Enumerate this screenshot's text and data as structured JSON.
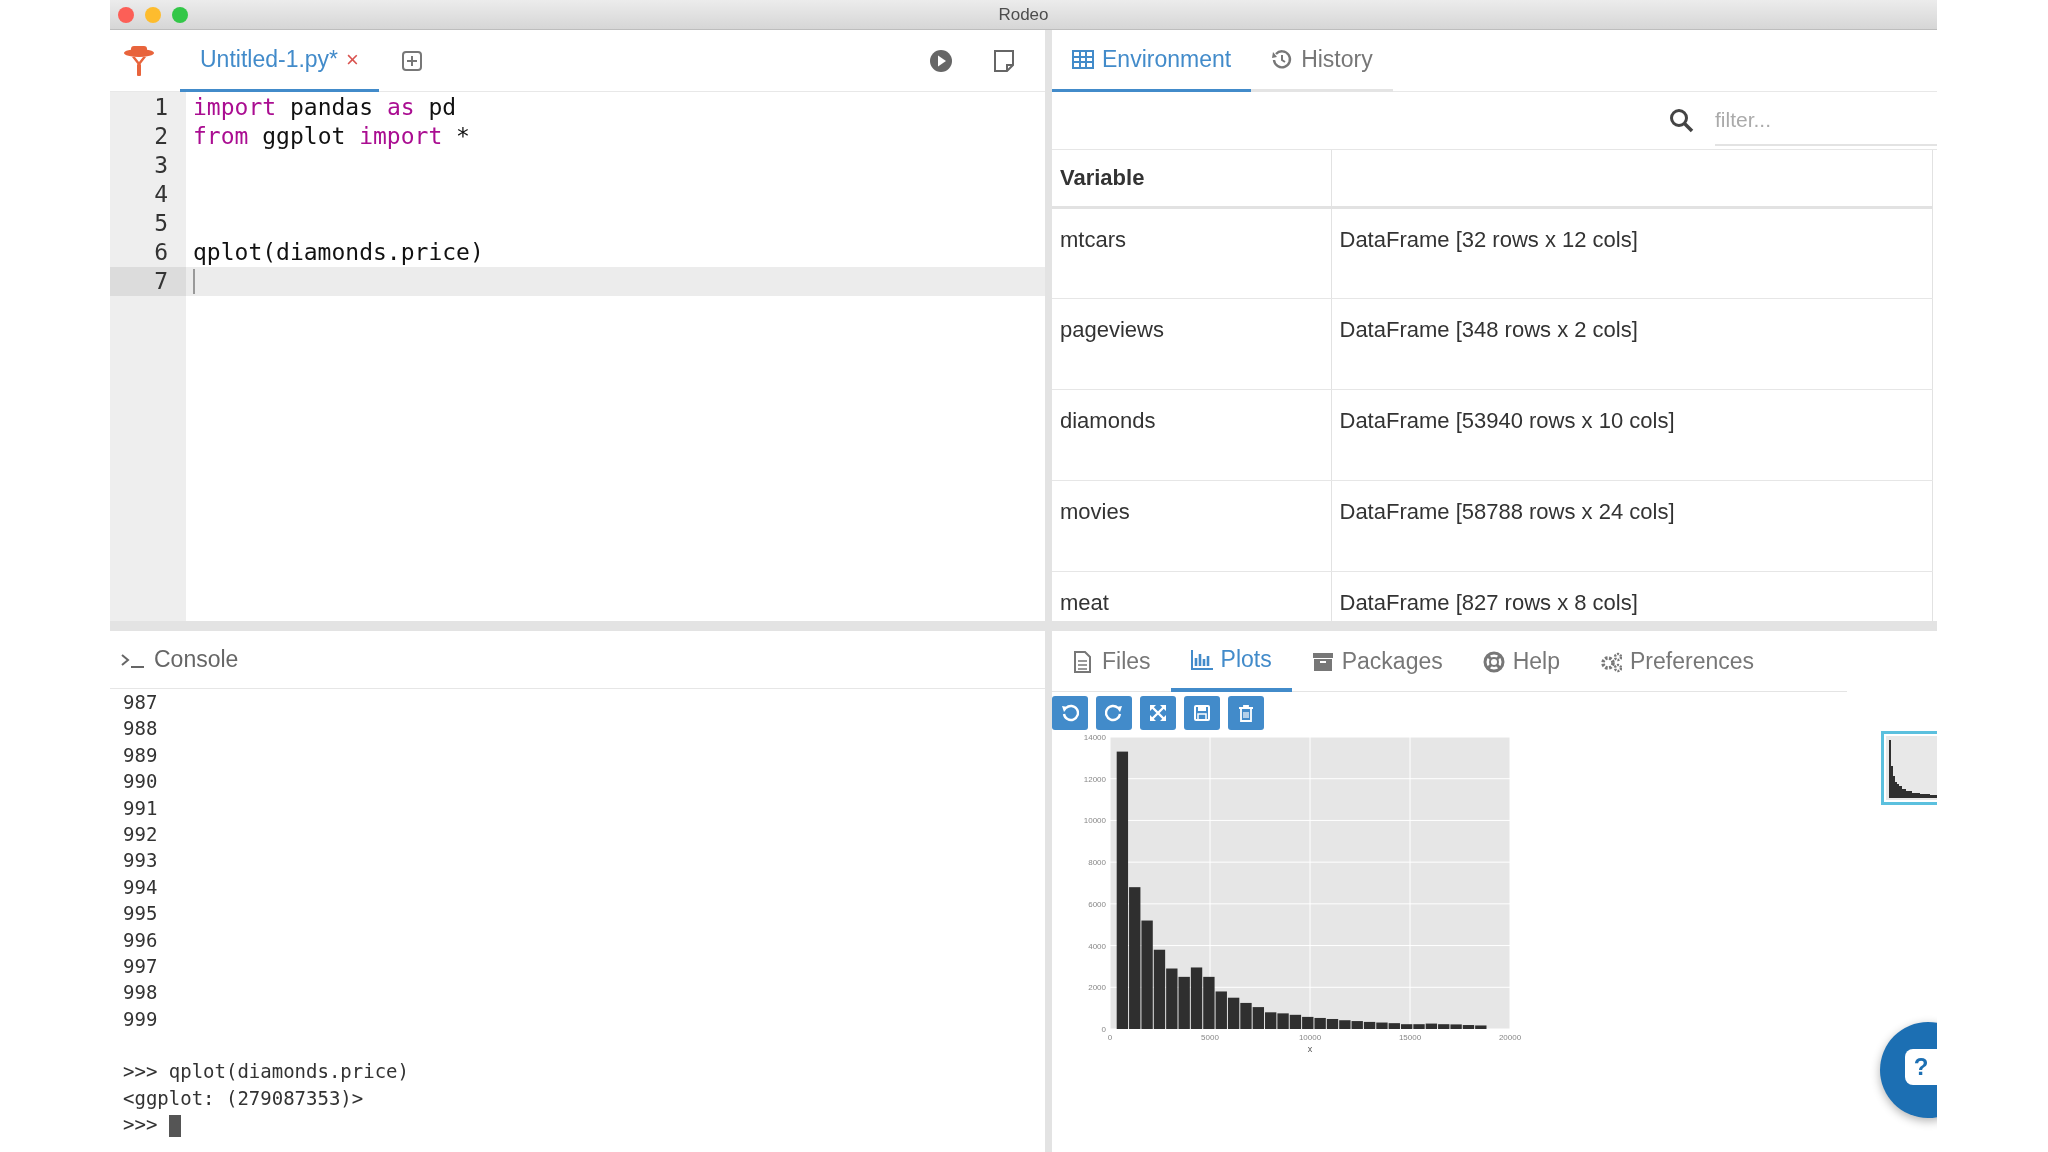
{
  "window": {
    "title": "Rodeo"
  },
  "editor": {
    "tabs": [
      {
        "label": "Untitled-1.py*",
        "close": "×",
        "selected": true
      }
    ],
    "lines": [
      {
        "number": "1",
        "current": false,
        "tokens": [
          {
            "text": "import",
            "kind": "keyword"
          },
          {
            "text": " pandas ",
            "kind": "plain"
          },
          {
            "text": "as",
            "kind": "keyword"
          },
          {
            "text": " pd",
            "kind": "plain"
          }
        ]
      },
      {
        "number": "2",
        "current": false,
        "tokens": [
          {
            "text": "from",
            "kind": "keyword"
          },
          {
            "text": " ggplot ",
            "kind": "plain"
          },
          {
            "text": "import",
            "kind": "keyword"
          },
          {
            "text": " *",
            "kind": "plain"
          }
        ]
      },
      {
        "number": "3",
        "current": false
      },
      {
        "number": "4",
        "current": false
      },
      {
        "number": "5",
        "current": false
      },
      {
        "number": "6",
        "current": false,
        "tokens": [
          {
            "text": "qplot(diamonds.price)",
            "kind": "plain"
          }
        ]
      },
      {
        "number": "7",
        "current": true
      }
    ]
  },
  "environment": {
    "tabs": [
      {
        "label": "Environment",
        "selected": true
      },
      {
        "label": "History",
        "selected": false
      }
    ],
    "filter": {
      "placeholder": "filter..."
    },
    "columns": [
      "Variable"
    ],
    "rows": [
      {
        "name": "mtcars",
        "value": "DataFrame [32 rows x 12 cols]"
      },
      {
        "name": "pageviews",
        "value": "DataFrame [348 rows x 2 cols]"
      },
      {
        "name": "diamonds",
        "value": "DataFrame [53940 rows x 10 cols]"
      },
      {
        "name": "movies",
        "value": "DataFrame [58788 rows x 24 cols]"
      },
      {
        "name": "meat",
        "value": "DataFrame [827 rows x 8 cols]"
      }
    ]
  },
  "console": {
    "title": "Console",
    "output": [
      "987",
      "988",
      "989",
      "990",
      "991",
      "992",
      "993",
      "994",
      "995",
      "996",
      "997",
      "998",
      "999"
    ],
    "session": [
      ">>> qplot(diamonds.price)",
      "<ggplot: (279087353)>"
    ],
    "prompt": ">>>"
  },
  "viewer": {
    "tabs": [
      {
        "label": "Files",
        "selected": false
      },
      {
        "label": "Plots",
        "selected": true
      },
      {
        "label": "Packages",
        "selected": false
      },
      {
        "label": "Help",
        "selected": false
      },
      {
        "label": "Preferences",
        "selected": false
      }
    ],
    "plot": {
      "chart_data": {
        "type": "bar",
        "xlabel": "x",
        "grid": true,
        "x": [
          619,
          1237,
          1855,
          2473,
          3091,
          3709,
          4327,
          4945,
          5563,
          6181,
          6799,
          7417,
          8035,
          8653,
          9271,
          9889,
          10507,
          11125,
          11743,
          12361,
          12979,
          13597,
          14215,
          14833,
          15451,
          16069,
          16687,
          17305,
          17923,
          18541
        ],
        "values": [
          13300,
          6800,
          5200,
          3800,
          2900,
          2500,
          2950,
          2500,
          1800,
          1500,
          1250,
          1050,
          800,
          750,
          680,
          580,
          530,
          480,
          420,
          380,
          340,
          310,
          280,
          230,
          230,
          260,
          230,
          220,
          190,
          170
        ],
        "xlim": [
          0,
          20000
        ],
        "ylim": [
          0,
          14000
        ],
        "xticks": [
          0,
          5000,
          10000,
          15000,
          20000
        ],
        "yticks": [
          0,
          2000,
          4000,
          6000,
          8000,
          10000,
          12000,
          14000
        ]
      }
    },
    "thumbnails": [
      {
        "selected": true
      }
    ]
  },
  "help_button": {
    "label": "?"
  }
}
